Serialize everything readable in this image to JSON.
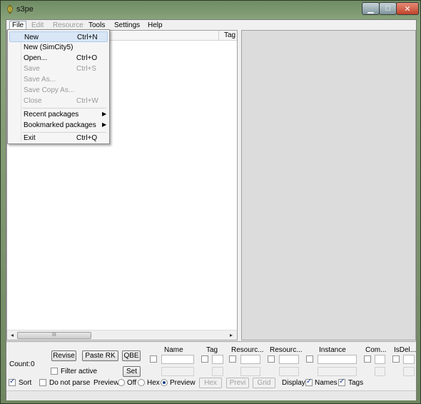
{
  "window": {
    "title": "s3pe",
    "minimize": "▁",
    "maximize": "□",
    "close": "✕",
    "icon": "app-leaf-icon"
  },
  "menubar": [
    {
      "label": "File",
      "state": "open"
    },
    {
      "label": "Edit",
      "state": "disabled"
    },
    {
      "label": "Resource",
      "state": "disabled"
    },
    {
      "label": "Tools",
      "state": "normal"
    },
    {
      "label": "Settings",
      "state": "normal"
    },
    {
      "label": "Help",
      "state": "normal"
    }
  ],
  "file_menu": {
    "items": [
      {
        "label": "New",
        "shortcut": "Ctrl+N",
        "highlighted": true
      },
      {
        "label": "New (SimCity5)",
        "shortcut": ""
      },
      {
        "label": "Open...",
        "shortcut": "Ctrl+O"
      },
      {
        "label": "Save",
        "shortcut": "Ctrl+S",
        "disabled": true
      },
      {
        "label": "Save As...",
        "shortcut": "",
        "disabled": true
      },
      {
        "label": "Save Copy As...",
        "shortcut": "",
        "disabled": true
      },
      {
        "label": "Close",
        "shortcut": "Ctrl+W",
        "disabled": true
      },
      {
        "label": "Recent packages",
        "shortcut": "",
        "submenu": true
      },
      {
        "label": "Bookmarked packages",
        "shortcut": "",
        "submenu": true
      },
      {
        "label": "Exit",
        "shortcut": "Ctrl+Q"
      }
    ]
  },
  "list": {
    "tag_header": "Tag",
    "scroll_left": "◂",
    "scroll_right": "▸",
    "grip": "III"
  },
  "bottom": {
    "count_label": "Count:",
    "count_value": "0",
    "revise": "Revise",
    "paste_rk": "Paste RK",
    "qbe": "QBE",
    "set": "Set",
    "filter_active": "Filter active",
    "filter_columns": [
      "Name",
      "Tag",
      "Resourc...",
      "Resourc...",
      "Instance",
      "Com...",
      "IsDel..."
    ],
    "sort": "Sort",
    "do_not_parse": "Do not parse",
    "preview_label": "Preview:",
    "preview_off": "Off",
    "preview_hex": "Hex",
    "preview_preview": "Preview",
    "hex_btn": "Hex",
    "previ_btn": "Previ",
    "grid_btn": "Grid",
    "display_label": "Display:",
    "names": "Names",
    "tags": "Tags"
  }
}
